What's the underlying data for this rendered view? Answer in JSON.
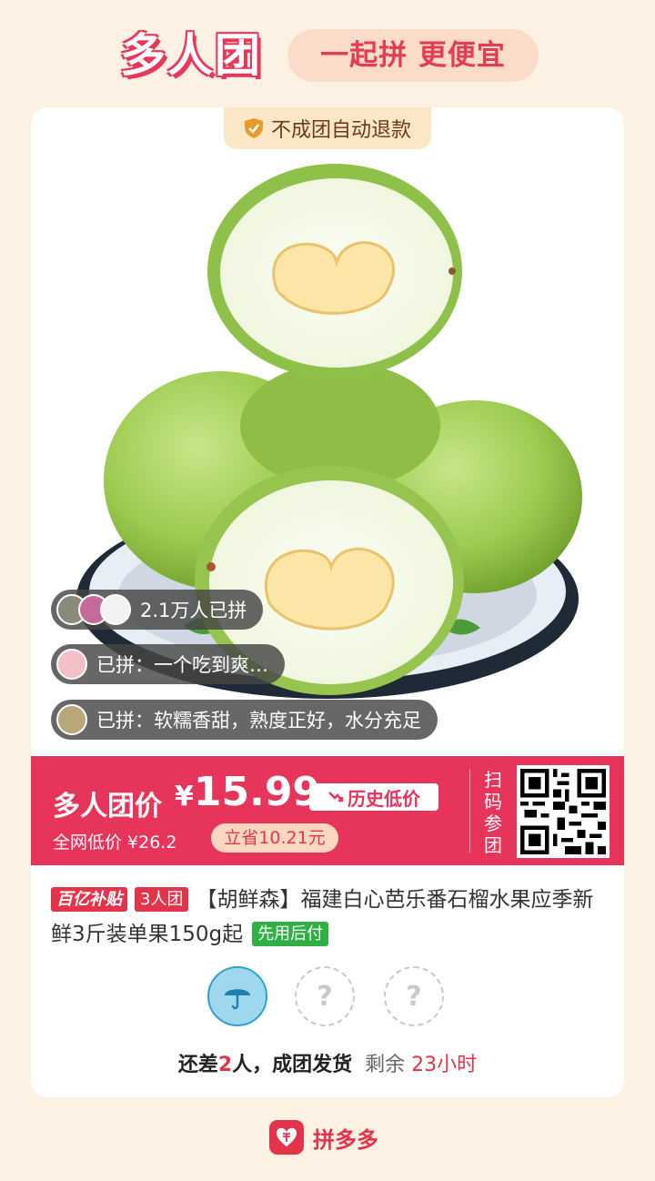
{
  "header": {
    "brand": "多人团",
    "slogan": "一起拼 更便宜"
  },
  "card": {
    "refund_tag": "不成团自动退款",
    "bubbles": {
      "joined_count": "2.1万人已拼",
      "review_1": "已拼：一个吃到爽…",
      "review_2": "已拼：软糯香甜，熟度正好，水分充足"
    },
    "price": {
      "label": "多人团价",
      "currency": "¥",
      "value": "15.99",
      "history_low": "历史低价",
      "market_label": "全网低价 ¥26.2",
      "save": "立省10.21元",
      "scan_label": "扫码参团",
      "color": "#e7345a"
    },
    "product": {
      "tag_subsidy": "百亿补贴",
      "tag_group": "3人团",
      "title": "【胡鲜森】福建白心芭乐番石榴水果应季新鲜3斤装单果150g起",
      "tag_paylater": "先用后付"
    },
    "status": {
      "prefix": "还差",
      "needed": "2",
      "suffix": "人，成团发货",
      "remain_label": "剩余",
      "remain_time": "23小时"
    },
    "slots": {
      "empty_mark": "?"
    }
  },
  "footer": {
    "app_name": "拼多多",
    "accent": "#e2344b"
  }
}
